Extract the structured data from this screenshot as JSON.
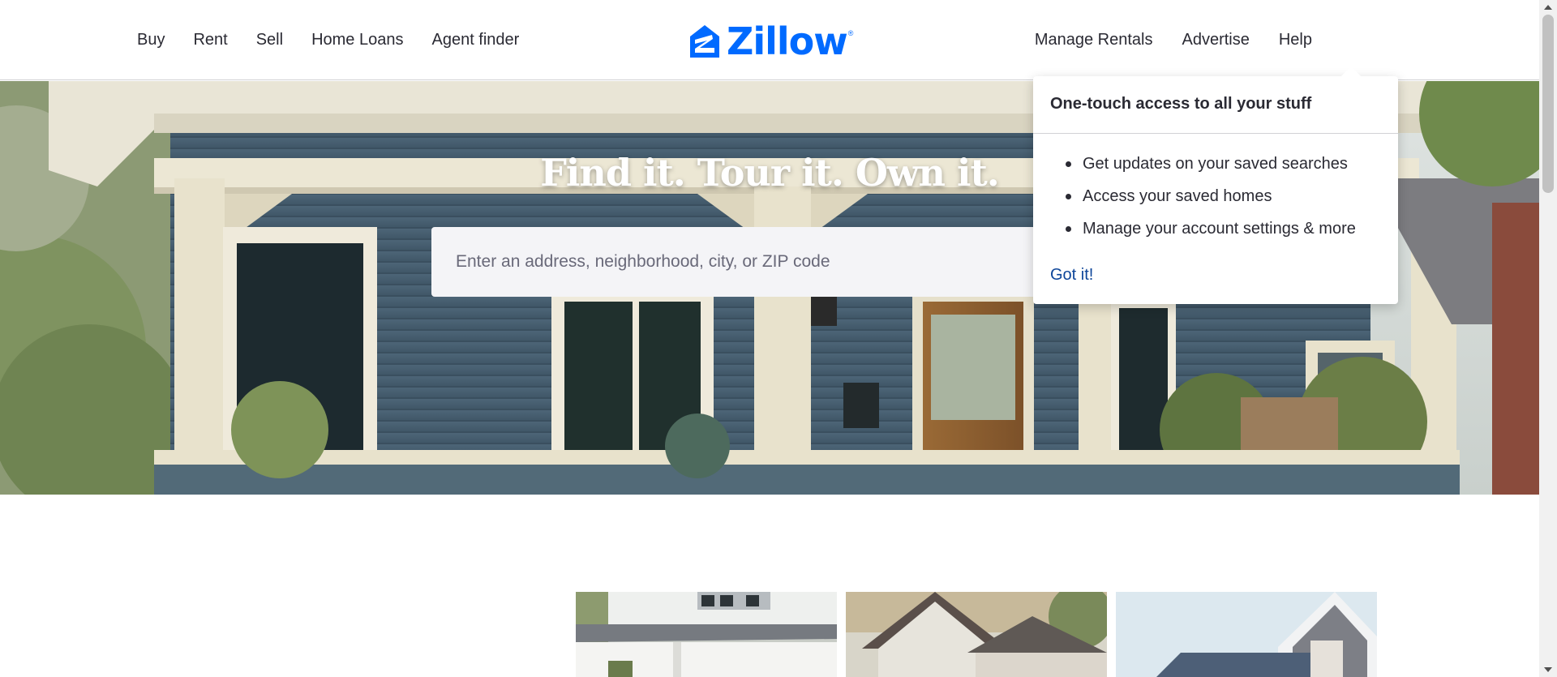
{
  "header": {
    "nav_left": [
      "Buy",
      "Rent",
      "Sell",
      "Home Loans",
      "Agent finder"
    ],
    "nav_right": [
      "Manage Rentals",
      "Advertise",
      "Help"
    ],
    "logo_text": "Zillow",
    "logo_registered": "®",
    "avatar_icon": "user-avatar-icon"
  },
  "hero": {
    "title": "Find it. Tour it. Own it.",
    "search_placeholder": "Enter an address, neighborhood, city, or ZIP code"
  },
  "popover": {
    "title": "One-touch access to all your stuff",
    "items": [
      "Get updates on your saved searches",
      "Access your saved homes",
      "Manage your account settings & more"
    ],
    "action": "Got it!"
  },
  "colors": {
    "brand_blue": "#006aff",
    "link_blue": "#0d4599",
    "text": "#2a2a33",
    "avatar_green": "#1a9a3b"
  },
  "icons": {
    "scroll_up": "triangle-up-icon",
    "scroll_down": "triangle-down-icon"
  }
}
